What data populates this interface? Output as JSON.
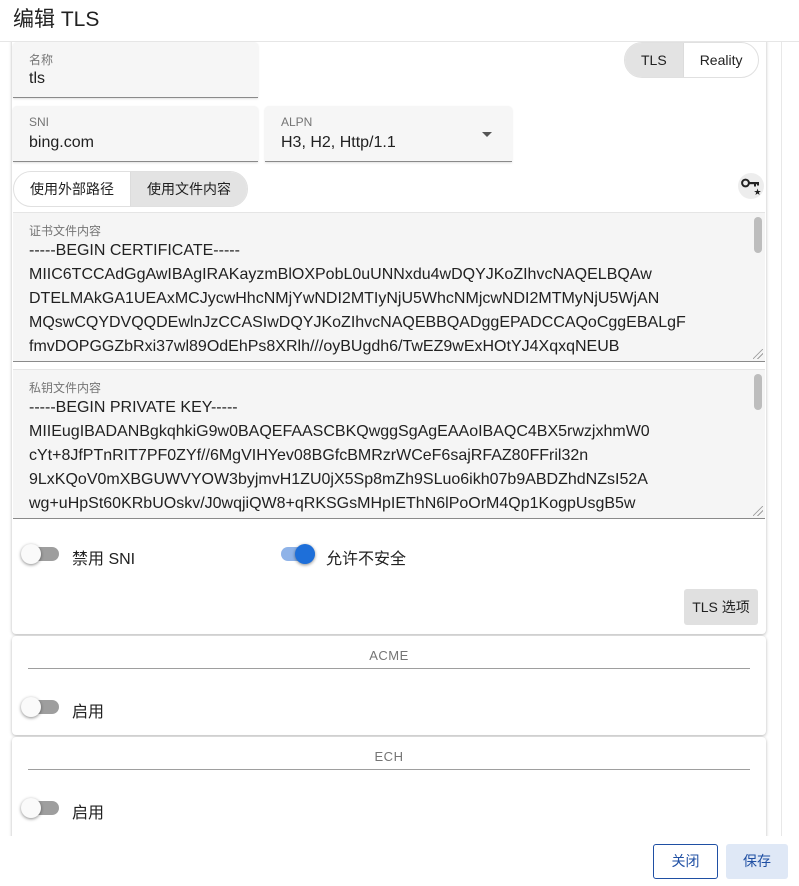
{
  "dialog": {
    "title": "编辑 TLS"
  },
  "tls_card": {
    "name_field": {
      "label": "名称",
      "value": "tls"
    },
    "protocol_toggle": {
      "tls_label": "TLS",
      "reality_label": "Reality",
      "selected": "TLS"
    },
    "sni_field": {
      "label": "SNI",
      "value": "bing.com"
    },
    "alpn_field": {
      "label": "ALPN",
      "value": "H3, H2, Http/1.1"
    },
    "source_toggle": {
      "external_label": "使用外部路径",
      "content_label": "使用文件内容",
      "selected": "使用文件内容"
    },
    "key_icon": "key-star-icon",
    "cert_area": {
      "label": "证书文件内容",
      "lines": [
        "-----BEGIN CERTIFICATE-----",
        "MIIC6TCCAdGgAwIBAgIRAKayzmBlOXPobL0uUNNxdu4wDQYJKoZIhvcNAQELBQAw",
        "DTELMAkGA1UEAxMCJycwHhcNMjYwNDI2MTIyNjU5WhcNMjcwNDI2MTMyNjU5WjAN",
        "MQswCQYDVQQDEwlnJzCCASIwDQYJKoZIhvcNAQEBBQADggEPADCCAQoCggEBALgF",
        "fmvDOPGGZbRxi37wl89OdEhPs8XRlh///oyBUgdh6/TwEZ9wExHOtYJ4XqxqNEUB"
      ]
    },
    "key_area": {
      "label": "私钥文件内容",
      "lines": [
        "-----BEGIN PRIVATE KEY-----",
        "MIIEugIBADANBgkqhkiG9w0BAQEFAASCBKQwggSgAgEAAoIBAQC4BX5rwzjxhmW0",
        "cYt+8JfPTnRIT7PF0ZYf//6MgVIHYev08BGfcBMRzrWCeF6sajRFAZ80FFril32n",
        "9LxKQoV0mXBGUWVYOW3byjmvH1ZU0jX5Sp8mZh9SLuo6ikh07b9ABDZhdNZsI52A",
        "wg+uHpSt60KRbUOskv/J0wqjiQW8+qRKSGsMHpIEThN6lPoOrM4Qp1KogpUsgB5w"
      ]
    },
    "disable_sni": {
      "label": "禁用 SNI",
      "on": false
    },
    "allow_insecure": {
      "label": "允许不安全",
      "on": true,
      "accent": "#1e6fd9"
    },
    "tls_options_button": "TLS 选项"
  },
  "acme_card": {
    "title": "ACME",
    "enable": {
      "label": "启用",
      "on": false
    }
  },
  "ech_card": {
    "title": "ECH",
    "enable": {
      "label": "启用",
      "on": false
    }
  },
  "footer": {
    "close_label": "关闭",
    "save_label": "保存"
  }
}
